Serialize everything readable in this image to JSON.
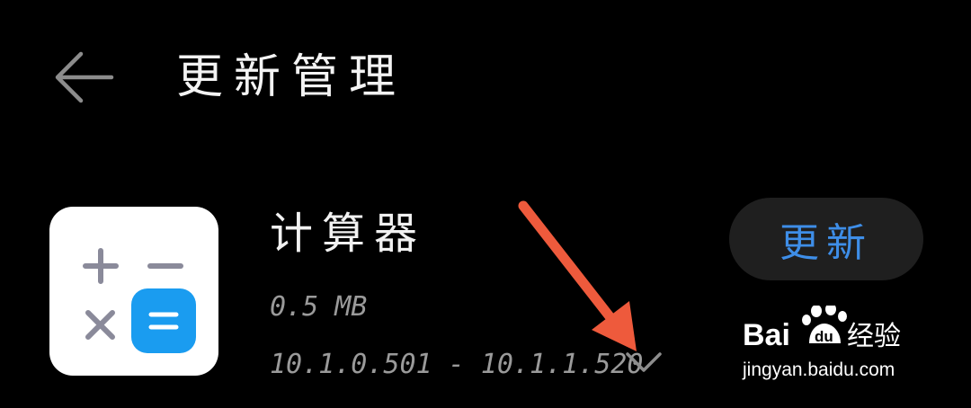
{
  "header": {
    "title": "更新管理",
    "back_icon": "back-arrow-icon"
  },
  "app": {
    "name": "计算器",
    "size": "0.5 MB",
    "version_change": "10.1.0.501 - 10.1.1.520",
    "icon": "calculator-app-icon",
    "icon_colors": {
      "background": "#ffffff",
      "symbols": "#8a8a9a",
      "equals_tile": "#1a9cf0"
    }
  },
  "actions": {
    "update_label": "更新",
    "update_color": "#3e8ee8",
    "expand_icon": "chevron-down-icon"
  },
  "annotation": {
    "arrow_color": "#ee5a3c"
  },
  "watermark": {
    "brand": "Bai du 经验",
    "url": "jingyan.baidu.com"
  },
  "colors": {
    "background": "#000000",
    "primary_text": "#f2f2f2",
    "secondary_text": "#9a9a9a",
    "button_bg": "#1f1f1f"
  }
}
